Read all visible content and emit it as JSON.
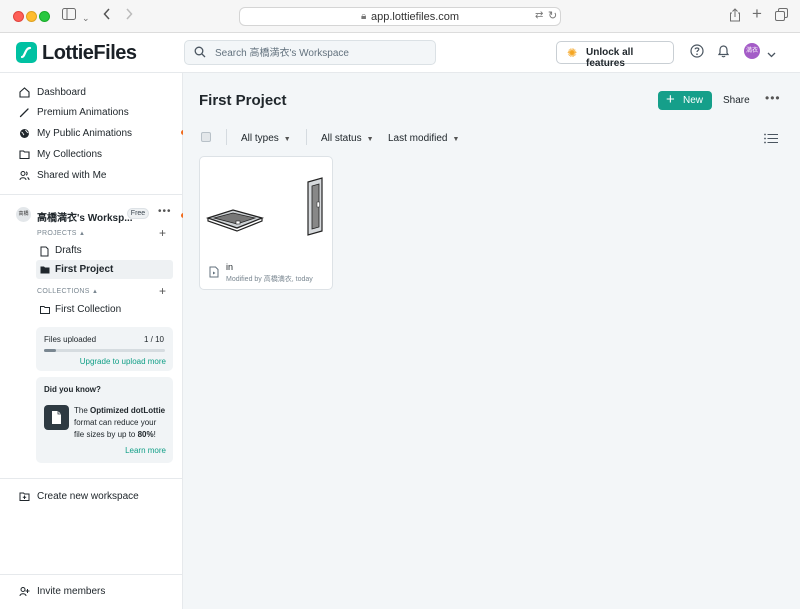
{
  "browser": {
    "url": "app.lottiefiles.com"
  },
  "header": {
    "brand": "LottieFiles",
    "search_placeholder": "Search 高橋満衣's Workspace",
    "unlock_label": "Unlock all features",
    "avatar_initials": "満衣"
  },
  "sidebar": {
    "nav": [
      {
        "label": "Dashboard",
        "icon": "home-icon"
      },
      {
        "label": "Premium Animations",
        "icon": "pen-icon"
      },
      {
        "label": "My Public Animations",
        "icon": "globe-icon"
      },
      {
        "label": "My Collections",
        "icon": "folder-icon"
      },
      {
        "label": "Shared with Me",
        "icon": "users-icon"
      }
    ],
    "workspace": {
      "avatar": "高橋",
      "name": "高橋満衣's Worksp...",
      "badge": "Free"
    },
    "projects_label": "PROJECTS",
    "projects": [
      {
        "label": "Drafts"
      },
      {
        "label": "First Project"
      }
    ],
    "collections_label": "COLLECTIONS",
    "collections": [
      {
        "label": "First Collection"
      }
    ],
    "files_uploaded": {
      "label": "Files uploaded",
      "count": "1 / 10",
      "progress": 0.1,
      "link": "Upgrade to upload more"
    },
    "did_you_know": {
      "title": "Did you know?",
      "pre": "The ",
      "bold1": "Optimized dotLottie",
      "mid": " format can reduce your file sizes by up to ",
      "bold2": "80%",
      "post": "!",
      "link": "Learn more"
    },
    "create_workspace": "Create new workspace",
    "invite": "Invite members"
  },
  "main": {
    "title": "First Project",
    "new_label": "New",
    "share_label": "Share",
    "filters": {
      "types": "All types",
      "status": "All status",
      "sort": "Last modified"
    },
    "files": [
      {
        "name": "in",
        "meta": "Modified by 高橋満衣, today"
      }
    ]
  },
  "colors": {
    "brand": "#00c1a2",
    "primary_button": "#159f8a",
    "link": "#0f9e86",
    "notification_dot": "#f06a1c"
  }
}
